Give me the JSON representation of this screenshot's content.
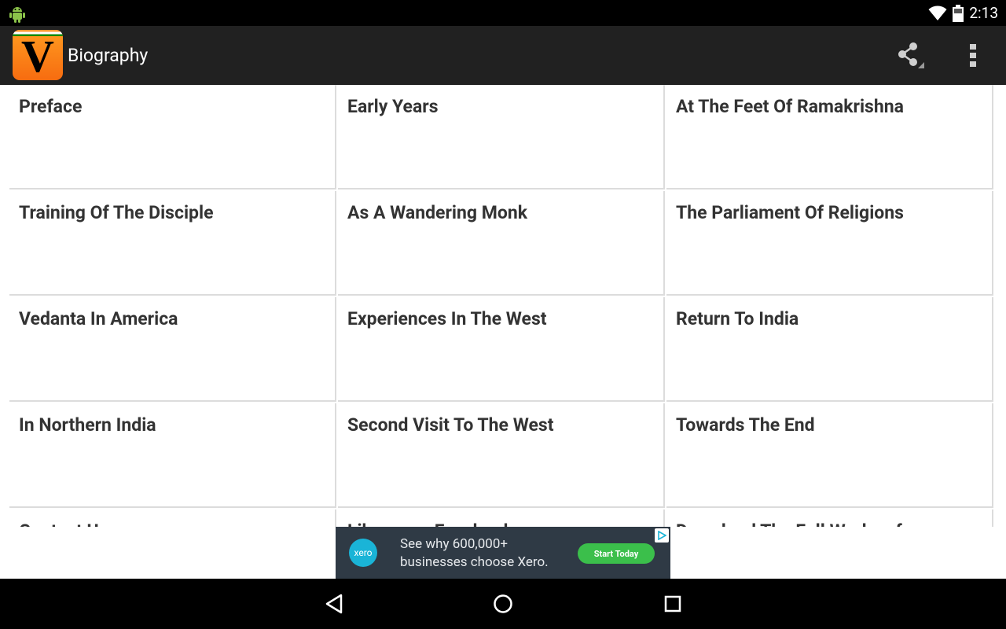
{
  "status_bar": {
    "time": "2:13",
    "icons": [
      "android-icon",
      "wifi-icon",
      "battery-icon"
    ]
  },
  "action_bar": {
    "app_icon_letter": "V",
    "title": "Biography",
    "share_icon": "share-icon",
    "overflow_icon": "overflow-menu-icon"
  },
  "chapters": [
    "Preface",
    "Early Years",
    "At The Feet Of Ramakrishna",
    "Training Of The Disciple",
    "As A Wandering Monk",
    "The Parliament Of Religions",
    "Vedanta In America",
    "Experiences In The West",
    "Return To India",
    "In Northern India",
    "Second Visit To The West",
    "Towards The End",
    "Contact Us",
    "Like us on Facebook",
    "Download The Full Works of"
  ],
  "ad": {
    "logo_text": "xero",
    "text": "See why 600,000+ businesses choose Xero.",
    "cta": "Start Today",
    "choices_icon": "ad-choices-icon"
  },
  "nav_bar": {
    "buttons": [
      "back-icon",
      "home-icon",
      "recents-icon"
    ]
  },
  "colors": {
    "status_bar": "#000000",
    "action_bar": "#212121",
    "grid_divider": "#dcdcdc",
    "cell_text": "#333333",
    "ad_background": "#2f3a45",
    "ad_cta": "#3bbf4b"
  }
}
